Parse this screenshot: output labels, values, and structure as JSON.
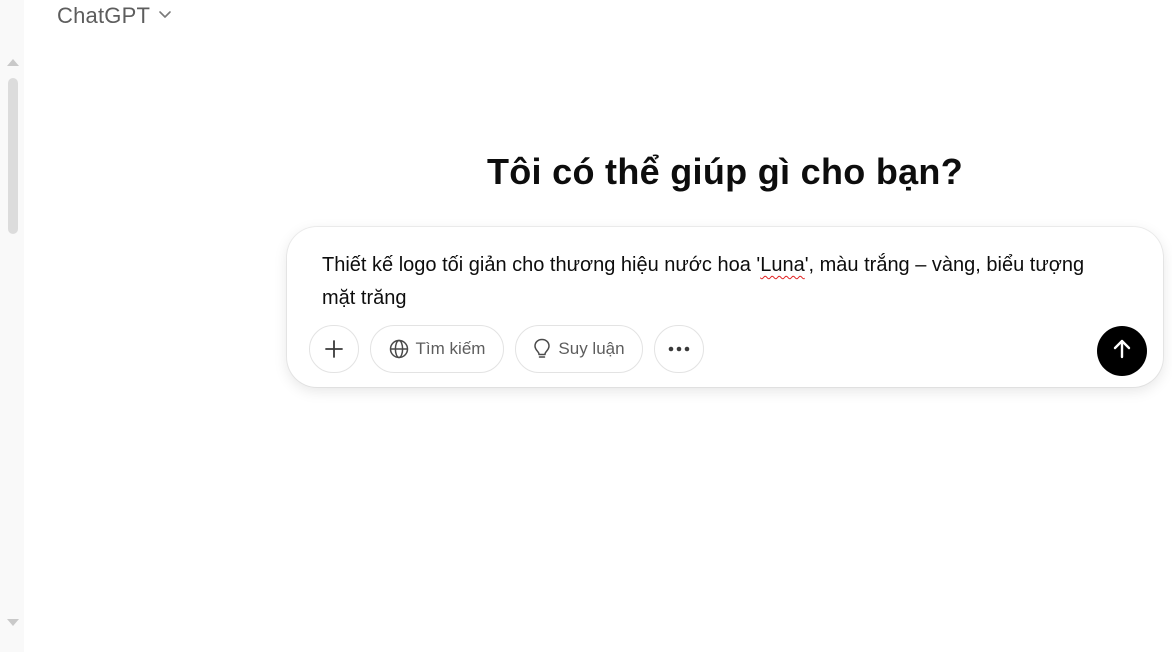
{
  "header": {
    "model_name": "ChatGPT",
    "model_dropdown_icon": "chevron-down-icon"
  },
  "main": {
    "headline": "Tôi có thể giúp gì cho bạn?"
  },
  "composer": {
    "prompt_before": "Thiết kế logo tối giản cho thương hiệu nước hoa '",
    "prompt_flagged_word": "Luna",
    "prompt_after": "', màu trắng – vàng, biểu tượng mặt trăng",
    "attach_icon": "plus-icon",
    "search_label": "Tìm kiếm",
    "search_icon": "globe-icon",
    "reason_label": "Suy luận",
    "reason_icon": "lightbulb-icon",
    "more_icon": "ellipsis-icon",
    "send_icon": "arrow-up-icon"
  },
  "colors": {
    "accent_send": "#000000",
    "spellcheck_underline": "#e02020",
    "muted_text": "#5d5d5d"
  }
}
